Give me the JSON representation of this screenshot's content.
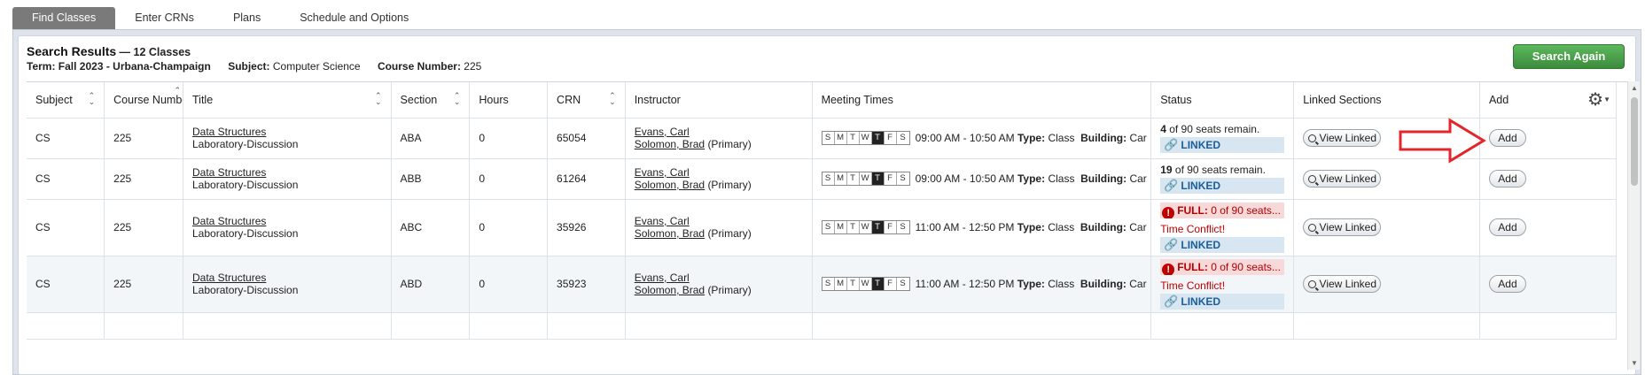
{
  "tabs": [
    {
      "label": "Find Classes",
      "active": true
    },
    {
      "label": "Enter CRNs"
    },
    {
      "label": "Plans"
    },
    {
      "label": "Schedule and Options"
    }
  ],
  "summary": {
    "title": "Search Results",
    "count": "— 12 Classes",
    "term_label": "Term:",
    "term_value": "Fall 2023 - Urbana-Champaign",
    "subject_label": "Subject:",
    "subject_value": "Computer Science",
    "course_label": "Course Number:",
    "course_value": "225"
  },
  "search_again_label": "Search Again",
  "columns": [
    "Subject",
    "Course Number",
    "Title",
    "Section",
    "Hours",
    "CRN",
    "Instructor",
    "Meeting Times",
    "Status",
    "Linked Sections",
    "Add"
  ],
  "day_letters": [
    "S",
    "M",
    "T",
    "W",
    "T",
    "F",
    "S"
  ],
  "rows": [
    {
      "subject": "CS",
      "course": "225",
      "title": "Data Structures",
      "subtitle": "Laboratory-Discussion",
      "section": "ABA",
      "hours": "0",
      "crn": "65054",
      "instructor1": "Evans, Carl",
      "instructor2": "Solomon, Brad",
      "primary": "(Primary)",
      "time": "09:00 AM - 10:50 AM",
      "type_label": "Type:",
      "type": "Class",
      "building_label": "Building:",
      "building": "Car",
      "status_kind": "open",
      "seats_num": "4",
      "seats_rest": "of 90 seats remain.",
      "linked": "LINKED",
      "view_linked": "View Linked",
      "add": "Add",
      "active_day": 4
    },
    {
      "subject": "CS",
      "course": "225",
      "title": "Data Structures",
      "subtitle": "Laboratory-Discussion",
      "section": "ABB",
      "hours": "0",
      "crn": "61264",
      "instructor1": "Evans, Carl",
      "instructor2": "Solomon, Brad",
      "primary": "(Primary)",
      "time": "09:00 AM - 10:50 AM",
      "type_label": "Type:",
      "type": "Class",
      "building_label": "Building:",
      "building": "Car",
      "status_kind": "open",
      "seats_num": "19",
      "seats_rest": "of 90 seats remain.",
      "linked": "LINKED",
      "view_linked": "View Linked",
      "add": "Add",
      "active_day": 4
    },
    {
      "subject": "CS",
      "course": "225",
      "title": "Data Structures",
      "subtitle": "Laboratory-Discussion",
      "section": "ABC",
      "hours": "0",
      "crn": "35926",
      "instructor1": "Evans, Carl",
      "instructor2": "Solomon, Brad",
      "primary": "(Primary)",
      "time": "11:00 AM - 12:50 PM",
      "type_label": "Type:",
      "type": "Class",
      "building_label": "Building:",
      "building": "Car",
      "status_kind": "full",
      "full_label": "FULL:",
      "full_rest": "0 of 90 seats...",
      "conflict": "Time Conflict!",
      "linked": "LINKED",
      "view_linked": "View Linked",
      "add": "Add",
      "active_day": 4
    },
    {
      "subject": "CS",
      "course": "225",
      "title": "Data Structures",
      "subtitle": "Laboratory-Discussion",
      "section": "ABD",
      "hours": "0",
      "crn": "35923",
      "instructor1": "Evans, Carl",
      "instructor2": "Solomon, Brad",
      "primary": "(Primary)",
      "time": "11:00 AM - 12:50 PM",
      "type_label": "Type:",
      "type": "Class",
      "building_label": "Building:",
      "building": "Car",
      "status_kind": "full",
      "full_label": "FULL:",
      "full_rest": "0 of 90 seats...",
      "conflict": "Time Conflict!",
      "linked": "LINKED",
      "view_linked": "View Linked",
      "add": "Add",
      "active_day": 4
    }
  ],
  "colors": {
    "accent_green": "#4cae4c",
    "linked_blue": "#1b5e9c",
    "full_red": "#c00000",
    "arrow_red": "#e3262b"
  }
}
